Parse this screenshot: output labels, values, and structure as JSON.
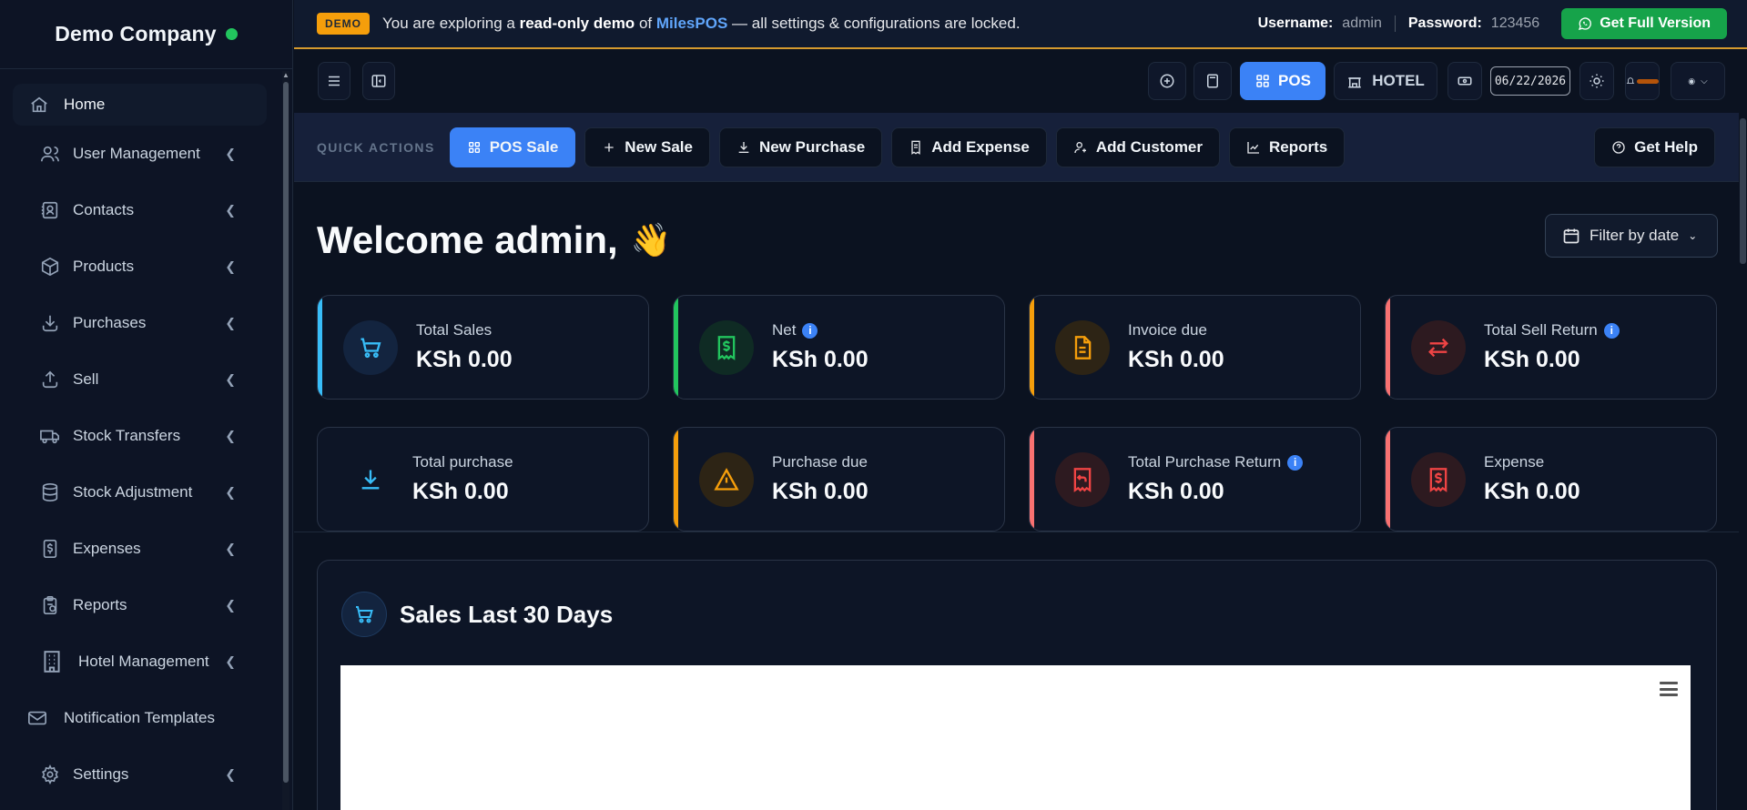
{
  "sidebar": {
    "brand": "Demo Company",
    "items": [
      {
        "label": "Home",
        "icon": "home-icon",
        "expandable": false
      },
      {
        "label": "User Management",
        "icon": "users-icon",
        "expandable": true
      },
      {
        "label": "Contacts",
        "icon": "contacts-icon",
        "expandable": true
      },
      {
        "label": "Products",
        "icon": "box-icon",
        "expandable": true
      },
      {
        "label": "Purchases",
        "icon": "download-icon",
        "expandable": true
      },
      {
        "label": "Sell",
        "icon": "upload-icon",
        "expandable": true
      },
      {
        "label": "Stock Transfers",
        "icon": "truck-icon",
        "expandable": true
      },
      {
        "label": "Stock Adjustment",
        "icon": "database-icon",
        "expandable": true
      },
      {
        "label": "Expenses",
        "icon": "dollar-file-icon",
        "expandable": true
      },
      {
        "label": "Reports",
        "icon": "clipboard-icon",
        "expandable": true
      },
      {
        "label": "Hotel Management",
        "icon": "building-icon",
        "expandable": true
      },
      {
        "label": "Notification Templates",
        "icon": "envelope-icon",
        "expandable": false
      },
      {
        "label": "Settings",
        "icon": "gear-icon",
        "expandable": true
      }
    ]
  },
  "banner": {
    "badge": "DEMO",
    "text_before": "You are exploring a",
    "text_bold": "read-only demo",
    "text_of": "of",
    "brand": "MilesPOS",
    "text_after": "— all settings & configurations are locked.",
    "username_label": "Username:",
    "username_value": "admin",
    "password_label": "Password:",
    "password_value": "123456",
    "full_version_label": "Get Full Version"
  },
  "toolbar": {
    "pos_label": "POS",
    "hotel_label": "HOTEL",
    "date_value": "06/22/2026"
  },
  "quick_actions": {
    "label": "QUICK ACTIONS",
    "buttons": [
      {
        "label": "POS Sale",
        "icon": "grid-icon"
      },
      {
        "label": "New Sale",
        "icon": "plus-icon"
      },
      {
        "label": "New Purchase",
        "icon": "download-icon"
      },
      {
        "label": "Add Expense",
        "icon": "receipt-icon"
      },
      {
        "label": "Add Customer",
        "icon": "user-plus-icon"
      },
      {
        "label": "Reports",
        "icon": "chart-line-icon"
      }
    ],
    "help_label": "Get Help"
  },
  "main": {
    "welcome": "Welcome admin,",
    "wave": "👋",
    "filter_label": "Filter by date",
    "cards": [
      {
        "title": "Total Sales",
        "value": "KSh 0.00",
        "info": false,
        "accent": "#38bdf8",
        "icon": "cart-icon"
      },
      {
        "title": "Net",
        "value": "KSh 0.00",
        "info": true,
        "accent": "#22c55e",
        "icon": "dollar-receipt-icon"
      },
      {
        "title": "Invoice due",
        "value": "KSh 0.00",
        "info": false,
        "accent": "#f59e0b",
        "icon": "invoice-icon"
      },
      {
        "title": "Total Sell Return",
        "value": "KSh 0.00",
        "info": true,
        "accent": "#f87171",
        "icon": "arrows-exchange-icon"
      },
      {
        "title": "Total purchase",
        "value": "KSh 0.00",
        "info": false,
        "accent": "none",
        "icon": "download-icon"
      },
      {
        "title": "Purchase due",
        "value": "KSh 0.00",
        "info": false,
        "accent": "#f59e0b",
        "icon": "warning-icon"
      },
      {
        "title": "Total Purchase Return",
        "value": "KSh 0.00",
        "info": true,
        "accent": "#f87171",
        "icon": "receipt-return-icon"
      },
      {
        "title": "Expense",
        "value": "KSh 0.00",
        "info": false,
        "accent": "#f87171",
        "icon": "dollar-receipt-icon"
      }
    ],
    "chart_title": "Sales Last 30 Days"
  }
}
